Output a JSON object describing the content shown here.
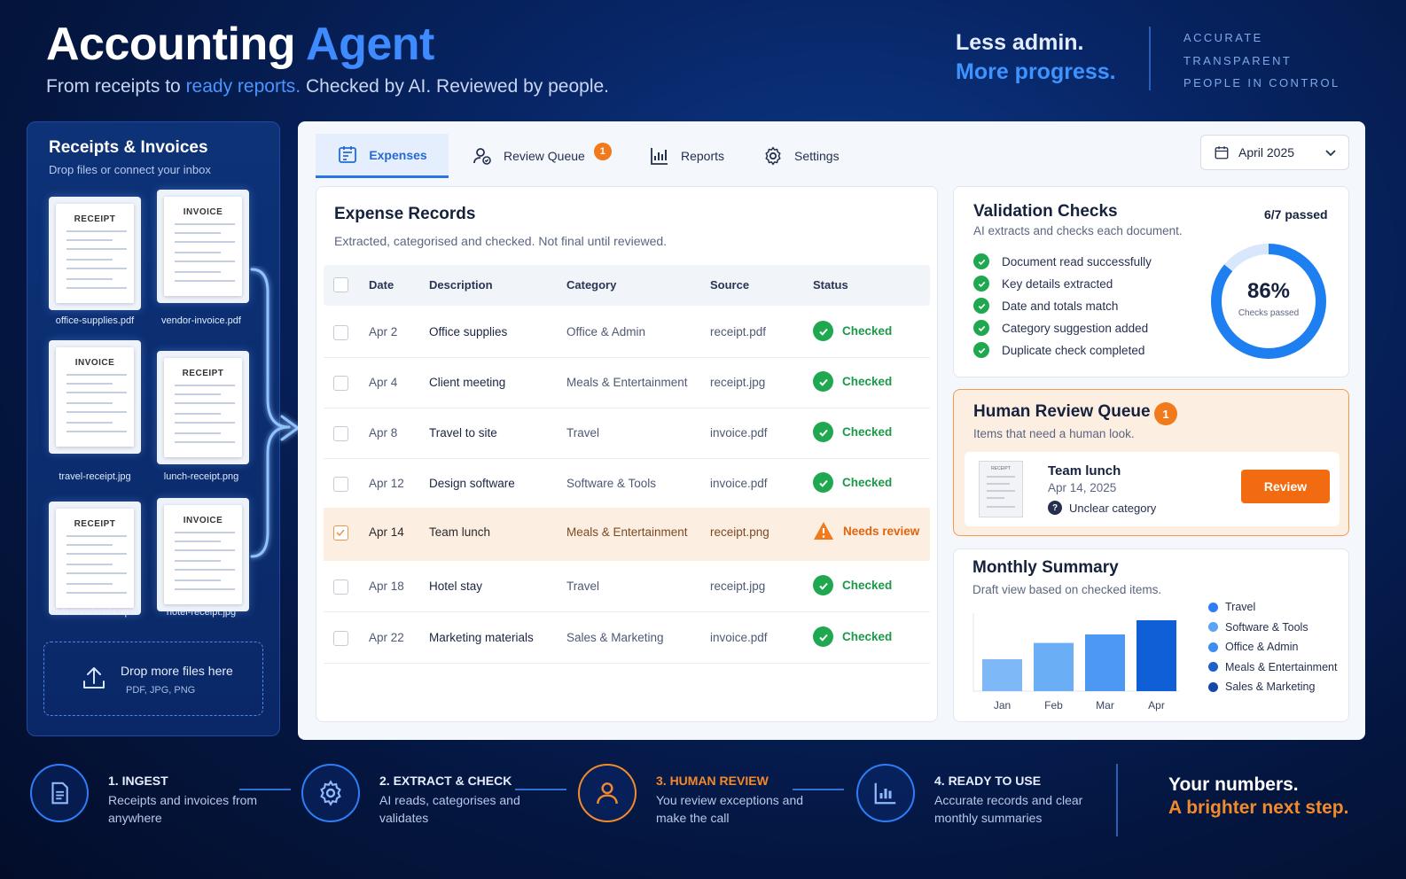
{
  "hero": {
    "title_main": "Accounting",
    "title_accent": "Agent",
    "sub_a": "From receipts to",
    "sub_accent": "ready reports.",
    "sub_b": "Checked by AI. Reviewed by people."
  },
  "tagline": {
    "line1": "Less admin.",
    "line2": "More progress."
  },
  "values": [
    "ACCURATE",
    "TRANSPARENT",
    "PEOPLE IN CONTROL"
  ],
  "sidebar": {
    "title": "Receipts & Invoices",
    "subtitle": "Drop files or connect your inbox",
    "files": [
      {
        "type": "RECEIPT",
        "name": "office-supplies.pdf"
      },
      {
        "type": "INVOICE",
        "name": "vendor-invoice.pdf"
      },
      {
        "type": "INVOICE",
        "name": "travel-receipt.jpg"
      },
      {
        "type": "RECEIPT",
        "name": "lunch-receipt.png"
      },
      {
        "type": "RECEIPT",
        "name": "software-invoice.pdf"
      },
      {
        "type": "INVOICE",
        "name": "hotel-receipt.jpg"
      }
    ],
    "drop_title": "Drop more files here",
    "drop_sub": "PDF, JPG, PNG"
  },
  "tabs": {
    "expenses": "Expenses",
    "review": "Review Queue",
    "review_badge": "1",
    "reports": "Reports",
    "settings": "Settings",
    "month": "April 2025"
  },
  "expenses": {
    "title": "Expense Records",
    "subtitle": "Extracted, categorised and checked. Not final until reviewed.",
    "columns": [
      "Date",
      "Description",
      "Category",
      "Source",
      "Status"
    ],
    "rows": [
      {
        "date": "Apr 2",
        "desc": "Office supplies",
        "category": "Office & Admin",
        "source": "receipt.pdf",
        "status": "Checked"
      },
      {
        "date": "Apr 4",
        "desc": "Client meeting",
        "category": "Meals & Entertainment",
        "source": "receipt.jpg",
        "status": "Checked"
      },
      {
        "date": "Apr 8",
        "desc": "Travel to site",
        "category": "Travel",
        "source": "invoice.pdf",
        "status": "Checked"
      },
      {
        "date": "Apr 12",
        "desc": "Design software",
        "category": "Software & Tools",
        "source": "invoice.pdf",
        "status": "Checked"
      },
      {
        "date": "Apr 14",
        "desc": "Team lunch",
        "category": "Meals & Entertainment",
        "source": "receipt.png",
        "status": "Needs review"
      },
      {
        "date": "Apr 18",
        "desc": "Hotel stay",
        "category": "Travel",
        "source": "receipt.jpg",
        "status": "Checked"
      },
      {
        "date": "Apr 22",
        "desc": "Marketing materials",
        "category": "Sales & Marketing",
        "source": "invoice.pdf",
        "status": "Checked"
      }
    ]
  },
  "validation": {
    "title": "Validation Checks",
    "passed": "6/7 passed",
    "subtitle": "AI extracts and checks each document.",
    "checks": [
      "Document read successfully",
      "Key details extracted",
      "Date and totals match",
      "Category suggestion added",
      "Duplicate check completed"
    ],
    "percent_value": 86,
    "percent_label": "86%",
    "percent_caption": "Checks passed"
  },
  "human_review": {
    "title": "Human Review Queue",
    "badge": "1",
    "subtitle": "Items that need a human look.",
    "item_name": "Team lunch",
    "item_date": "Apr 14, 2025",
    "item_reason": "Unclear category",
    "thumb_label": "RECEIPT",
    "button": "Review"
  },
  "summary": {
    "title": "Monthly Summary",
    "subtitle": "Draft view based on checked items.",
    "legend": [
      {
        "name": "Travel",
        "color": "#2f7df5"
      },
      {
        "name": "Software & Tools",
        "color": "#5aa3f5"
      },
      {
        "name": "Office & Admin",
        "color": "#3d8ef0"
      },
      {
        "name": "Meals & Entertainment",
        "color": "#1e5fc8"
      },
      {
        "name": "Sales & Marketing",
        "color": "#1448a8"
      }
    ]
  },
  "chart_data": {
    "type": "bar",
    "categories": [
      "Jan",
      "Feb",
      "Mar",
      "Apr"
    ],
    "values": [
      45,
      68,
      80,
      100
    ],
    "colors": [
      "#7fb8f7",
      "#6aaef5",
      "#4d98f2",
      "#0f5fd6"
    ],
    "ylim": [
      0,
      100
    ],
    "grid": false
  },
  "steps": [
    {
      "title": "1. INGEST",
      "desc": "Receipts and invoices from anywhere",
      "icon": "document-icon"
    },
    {
      "title": "2. EXTRACT & CHECK",
      "desc": "AI reads, categorises and validates",
      "icon": "gear-icon"
    },
    {
      "title": "3. HUMAN REVIEW",
      "desc": "You review exceptions and make the call",
      "icon": "person-icon"
    },
    {
      "title": "4. READY TO USE",
      "desc": "Accurate records and clear monthly summaries",
      "icon": "bar-chart-icon"
    }
  ],
  "footer": {
    "line1": "Your numbers.",
    "line2": "A brighter next step."
  }
}
